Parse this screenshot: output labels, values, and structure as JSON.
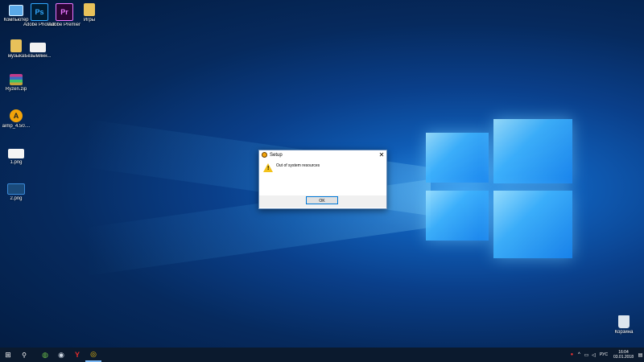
{
  "desktop_icons": [
    {
      "label": "Компьютер",
      "icon": "computer-icon"
    },
    {
      "label": "Adobe Photosh...",
      "icon": "photoshop-icon",
      "glyph": "Ps"
    },
    {
      "label": "Adobe Premiere P...",
      "icon": "premiere-icon",
      "glyph": "Pr"
    },
    {
      "label": "Игры",
      "icon": "folder-icon"
    },
    {
      "label": "музыка",
      "icon": "folder-icon"
    },
    {
      "label": "Безымянн...",
      "icon": "image-file-icon"
    },
    {
      "label": "Ryzen.zip",
      "icon": "archive-icon"
    },
    {
      "label": "aimp_4.50....",
      "icon": "aimp-icon"
    },
    {
      "label": "1.png",
      "icon": "image-file-icon"
    },
    {
      "label": "2.png",
      "icon": "image-file-icon"
    },
    {
      "label": "Корзина",
      "icon": "recycle-bin-icon"
    }
  ],
  "dialog": {
    "title": "Setup",
    "message": "Out of system resources",
    "ok_label": "OK",
    "close_glyph": "✕"
  },
  "taskbar": {
    "start_glyph": "⊞",
    "search_glyph": "⚲",
    "apps": [
      {
        "icon": "green-app-icon",
        "glyph": "◍"
      },
      {
        "icon": "steam-icon",
        "glyph": "◉"
      },
      {
        "icon": "yandex-browser-icon",
        "glyph": "Y"
      },
      {
        "icon": "chrome-icon",
        "glyph": "◎"
      }
    ],
    "tray": {
      "lang": "РУС",
      "time": "16:04",
      "date": "03.01.2018"
    }
  },
  "colors": {
    "accent": "#0078d7",
    "taskbar": "#0b1a2e",
    "warning": "#f3c21a"
  }
}
